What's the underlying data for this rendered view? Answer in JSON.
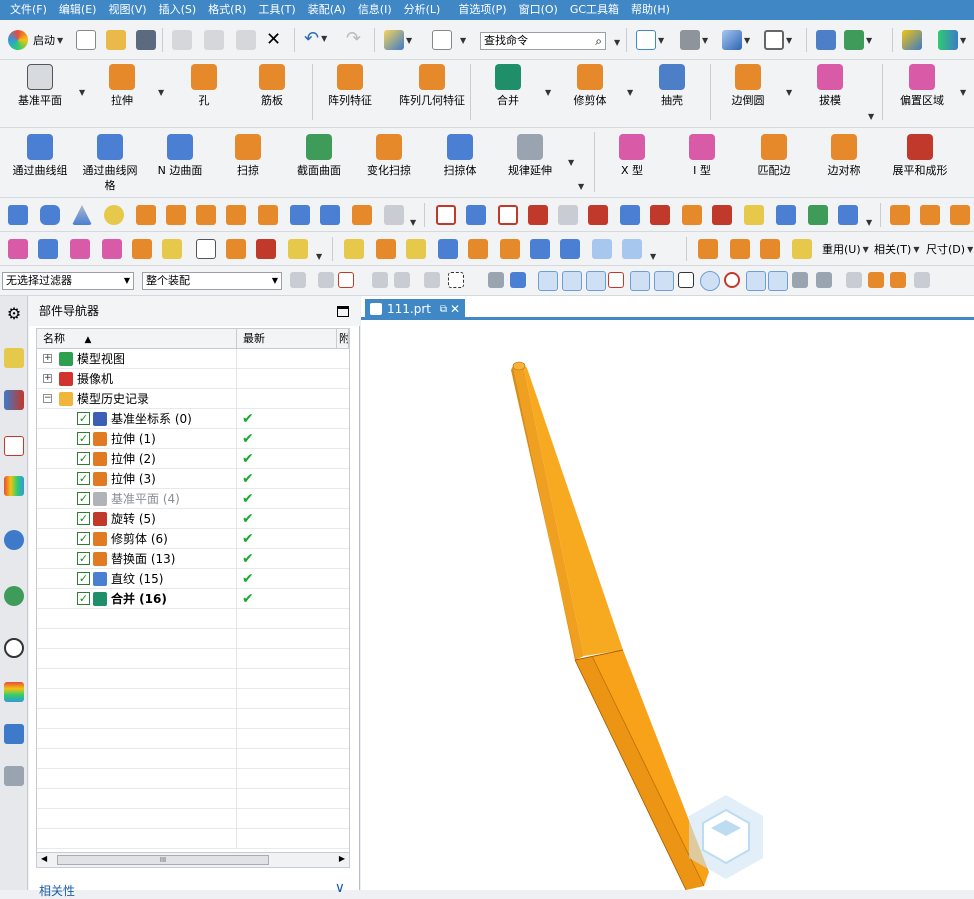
{
  "menu": [
    "文件(F)",
    "编辑(E)",
    "视图(V)",
    "插入(S)",
    "格式(R)",
    "工具(T)",
    "装配(A)",
    "信息(I)",
    "分析(L)",
    "首选项(P)",
    "窗口(O)",
    "GC工具箱",
    "帮助(H)"
  ],
  "standard_toolbar": {
    "start_label": "启动",
    "search_placeholder": "查找命令"
  },
  "feature_toolbar": [
    "基准平面",
    "拉伸",
    "孔",
    "筋板",
    "阵列特征",
    "阵列几何特征",
    "合并",
    "修剪体",
    "抽壳",
    "边倒圆",
    "拔模",
    "偏置区域"
  ],
  "surface_toolbar": [
    "通过曲线组",
    "通过曲线网格",
    "N 边曲面",
    "扫掠",
    "截面曲面",
    "变化扫掠",
    "扫掠体",
    "规律延伸",
    "X 型",
    "I 型",
    "匹配边",
    "边对称",
    "展平和成形"
  ],
  "row5_labels": {
    "reuse": "重用(U)",
    "related": "相关(T)",
    "dimension": "尺寸(D)"
  },
  "selection_bar": {
    "filter": "无选择过滤器",
    "scope": "整个装配"
  },
  "navigator": {
    "title": "部件导航器",
    "columns": [
      "名称",
      "最新",
      "附"
    ],
    "nodes": [
      {
        "label": "模型视图",
        "level": 0,
        "expander": "+",
        "icon": "model-view-icon",
        "color": "#2e9e4f"
      },
      {
        "label": "摄像机",
        "level": 0,
        "expander": "+",
        "icon": "camera-icon",
        "color": "#d1342f"
      },
      {
        "label": "模型历史记录",
        "level": 0,
        "expander": "-",
        "icon": "folder-icon",
        "color": "#f0b53a"
      },
      {
        "label": "基准坐标系 (0)",
        "level": 1,
        "icon": "datum-csys-icon",
        "color": "#3b5fb5",
        "latest": true
      },
      {
        "label": "拉伸 (1)",
        "level": 1,
        "icon": "extrude-icon",
        "color": "#e07b24",
        "latest": true
      },
      {
        "label": "拉伸 (2)",
        "level": 1,
        "icon": "extrude-icon",
        "color": "#e07b24",
        "latest": true
      },
      {
        "label": "拉伸 (3)",
        "level": 1,
        "icon": "extrude-icon",
        "color": "#e07b24",
        "latest": true
      },
      {
        "label": "基准平面 (4)",
        "level": 1,
        "icon": "datum-plane-icon",
        "color": "#b0b4b9",
        "latest": true,
        "muted": true
      },
      {
        "label": "旋转 (5)",
        "level": 1,
        "icon": "revolve-icon",
        "color": "#c0392b",
        "latest": true
      },
      {
        "label": "修剪体 (6)",
        "level": 1,
        "icon": "trim-body-icon",
        "color": "#e07b24",
        "latest": true
      },
      {
        "label": "替换面 (13)",
        "level": 1,
        "icon": "replace-face-icon",
        "color": "#e07b24",
        "latest": true
      },
      {
        "label": "直纹 (15)",
        "level": 1,
        "icon": "ruled-icon",
        "color": "#4a7fd4",
        "latest": true
      },
      {
        "label": "合并 (16)",
        "level": 1,
        "icon": "unite-icon",
        "color": "#1f8f6a",
        "latest": true,
        "bold": true
      }
    ],
    "related_label": "相关性"
  },
  "tab": {
    "label": "111.prt"
  },
  "colors": {
    "accent": "#3f88c5",
    "model": "#f39c12",
    "check": "#15a830"
  }
}
